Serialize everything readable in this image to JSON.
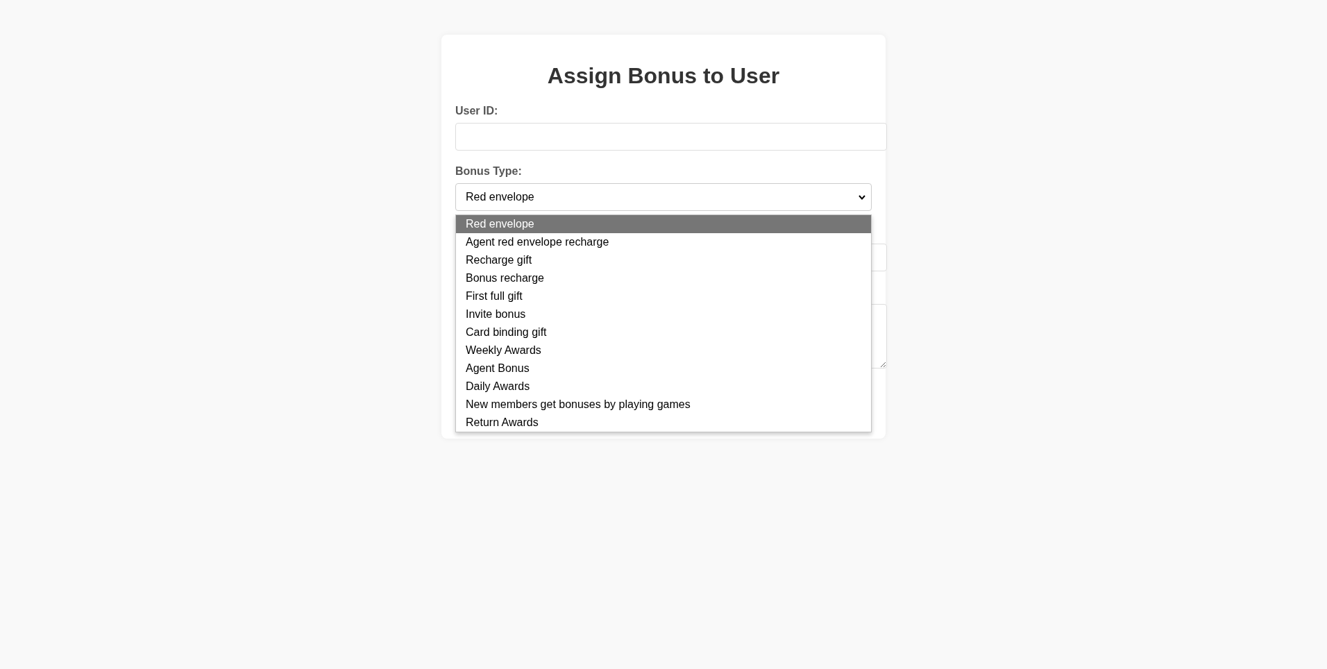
{
  "form": {
    "title": "Assign Bonus to User",
    "fields": [
      {
        "kind": "input",
        "label": "User ID:"
      },
      {
        "kind": "select",
        "label": "Bonus Type:",
        "value": "Red envelope",
        "expanded": true,
        "options": [
          {
            "label": "Red envelope",
            "selected": true
          },
          {
            "label": "Agent red envelope recharge",
            "selected": false
          },
          {
            "label": "Recharge gift",
            "selected": false
          },
          {
            "label": "Bonus recharge",
            "selected": false
          },
          {
            "label": "First full gift",
            "selected": false
          },
          {
            "label": "Invite bonus",
            "selected": false
          },
          {
            "label": "Card binding gift",
            "selected": false
          },
          {
            "label": "Weekly Awards",
            "selected": false
          },
          {
            "label": "Agent Bonus",
            "selected": false
          },
          {
            "label": "Daily Awards",
            "selected": false
          },
          {
            "label": "New members get bonuses by playing games",
            "selected": false
          },
          {
            "label": "Return Awards",
            "selected": false
          }
        ]
      },
      {
        "kind": "input"
      },
      {
        "kind": "textarea"
      }
    ]
  }
}
